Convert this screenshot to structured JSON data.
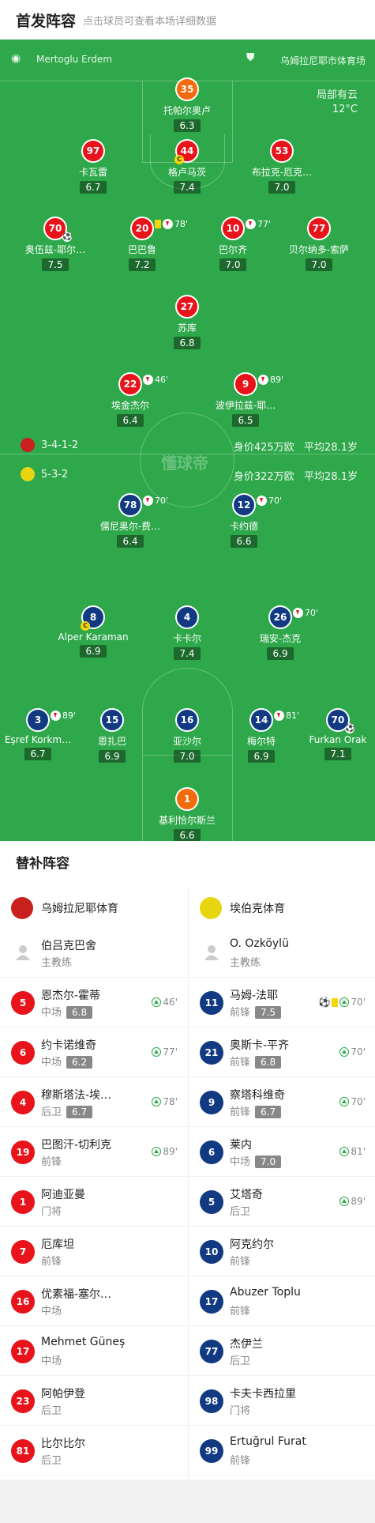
{
  "header": {
    "title": "首发阵容",
    "subtitle": "点击球员可查看本场详细数据"
  },
  "field": {
    "referee": "Mertoglu Erdem",
    "venue": "乌姆拉尼耶市体育场",
    "weather": "局部有云",
    "temp": "12°C",
    "watermark": "懂球帝"
  },
  "home": {
    "formation": "3-4-1-2",
    "value": "身价425万欧",
    "age": "平均28.1岁",
    "color": "#e8131b"
  },
  "away": {
    "formation": "5-3-2",
    "value": "身价322万欧",
    "age": "平均28.1岁",
    "color": "#123a82"
  },
  "players": [
    {
      "num": "35",
      "name": "托帕尔奥卢",
      "rating": "6.3",
      "side": "gk"
    },
    {
      "num": "97",
      "name": "卡瓦雷",
      "rating": "6.7",
      "side": "h"
    },
    {
      "num": "44",
      "name": "格卢马茨",
      "rating": "7.4",
      "side": "h",
      "cap": "C"
    },
    {
      "num": "53",
      "name": "布拉克-厄克…",
      "rating": "7.0",
      "side": "h"
    },
    {
      "num": "70",
      "name": "奥伍兹-耶尔…",
      "rating": "7.5",
      "side": "h",
      "ball": "⚽"
    },
    {
      "num": "20",
      "name": "巴巴鲁",
      "rating": "7.2",
      "side": "h",
      "yc": true,
      "ev": "78'"
    },
    {
      "num": "10",
      "name": "巴尔齐",
      "rating": "7.0",
      "side": "h",
      "ev": "77'"
    },
    {
      "num": "77",
      "name": "贝尔纳多-索萨",
      "rating": "7.0",
      "side": "h"
    },
    {
      "num": "27",
      "name": "苏库",
      "rating": "6.8",
      "side": "h"
    },
    {
      "num": "22",
      "name": "埃金杰尔",
      "rating": "6.4",
      "side": "h",
      "ev": "46'"
    },
    {
      "num": "9",
      "name": "波伊拉兹-耶…",
      "rating": "6.5",
      "side": "h",
      "ev": "89'"
    },
    {
      "num": "78",
      "name": "儒尼奥尔-费…",
      "rating": "6.4",
      "side": "a",
      "ev": "70'"
    },
    {
      "num": "12",
      "name": "卡约德",
      "rating": "6.6",
      "side": "a",
      "ev": "70'"
    },
    {
      "num": "8",
      "name": "Alper Karaman",
      "rating": "6.9",
      "side": "a",
      "cap": "C"
    },
    {
      "num": "4",
      "name": "卡卡尔",
      "rating": "7.4",
      "side": "a"
    },
    {
      "num": "26",
      "name": "瑞安-杰克",
      "rating": "6.9",
      "side": "a",
      "ev": "70'"
    },
    {
      "num": "3",
      "name": "Eşref Korkm…",
      "rating": "6.7",
      "side": "a",
      "ev": "89'"
    },
    {
      "num": "15",
      "name": "恩扎巴",
      "rating": "6.9",
      "side": "a"
    },
    {
      "num": "16",
      "name": "亚沙尔",
      "rating": "7.0",
      "side": "a"
    },
    {
      "num": "14",
      "name": "梅尔特",
      "rating": "6.9",
      "side": "a",
      "ev": "81'"
    },
    {
      "num": "70",
      "name": "Furkan Orak",
      "rating": "7.1",
      "side": "a",
      "ball": "⚽"
    },
    {
      "num": "1",
      "name": "基利恰尔斯兰",
      "rating": "6.6",
      "side": "gk"
    }
  ],
  "subs": {
    "title": "替补阵容",
    "home_team": "乌姆拉尼耶体育",
    "away_team": "埃伯克体育",
    "home": [
      {
        "name": "伯吕克巴舍",
        "pos": "主教练",
        "coach": true
      },
      {
        "num": "5",
        "name": "恩杰尔-霍蒂",
        "pos": "中场",
        "rating": "6.8",
        "ev": "46'"
      },
      {
        "num": "6",
        "name": "约卡诺维奇",
        "pos": "中场",
        "rating": "6.2",
        "ev": "77'"
      },
      {
        "num": "4",
        "name": "穆斯塔法-埃…",
        "pos": "后卫",
        "rating": "6.7",
        "ev": "78'"
      },
      {
        "num": "19",
        "name": "巴图汗-切利克",
        "pos": "前锋",
        "ev": "89'"
      },
      {
        "num": "1",
        "name": "阿迪亚曼",
        "pos": "门将"
      },
      {
        "num": "7",
        "name": "厄库坦",
        "pos": "前锋"
      },
      {
        "num": "16",
        "name": "优素福-塞尔…",
        "pos": "中场"
      },
      {
        "num": "17",
        "name": "Mehmet Güneş",
        "pos": "中场"
      },
      {
        "num": "23",
        "name": "阿帕伊登",
        "pos": "后卫"
      },
      {
        "num": "81",
        "name": "比尔比尔",
        "pos": "后卫"
      }
    ],
    "away": [
      {
        "name": "O. Özköylü",
        "pos": "主教练",
        "coach": true
      },
      {
        "num": "11",
        "name": "马姆-法耶",
        "pos": "前锋",
        "rating": "7.5",
        "ev": "70'",
        "ball": "⚽",
        "yc": true
      },
      {
        "num": "21",
        "name": "奥斯卡-平齐",
        "pos": "前锋",
        "rating": "6.8",
        "ev": "70'"
      },
      {
        "num": "9",
        "name": "察塔科维奇",
        "pos": "前锋",
        "rating": "6.7",
        "ev": "70'"
      },
      {
        "num": "6",
        "name": "莱内",
        "pos": "中场",
        "rating": "7.0",
        "ev": "81'"
      },
      {
        "num": "5",
        "name": "艾塔奇",
        "pos": "后卫",
        "ev": "89'"
      },
      {
        "num": "10",
        "name": "阿克约尔",
        "pos": "前锋"
      },
      {
        "num": "17",
        "name": "Abuzer Toplu",
        "pos": "前锋"
      },
      {
        "num": "77",
        "name": "杰伊兰",
        "pos": "后卫"
      },
      {
        "num": "98",
        "name": "卡夫卡西拉里",
        "pos": "门将"
      },
      {
        "num": "99",
        "name": "Ertuğrul Furat",
        "pos": "前锋"
      }
    ]
  }
}
